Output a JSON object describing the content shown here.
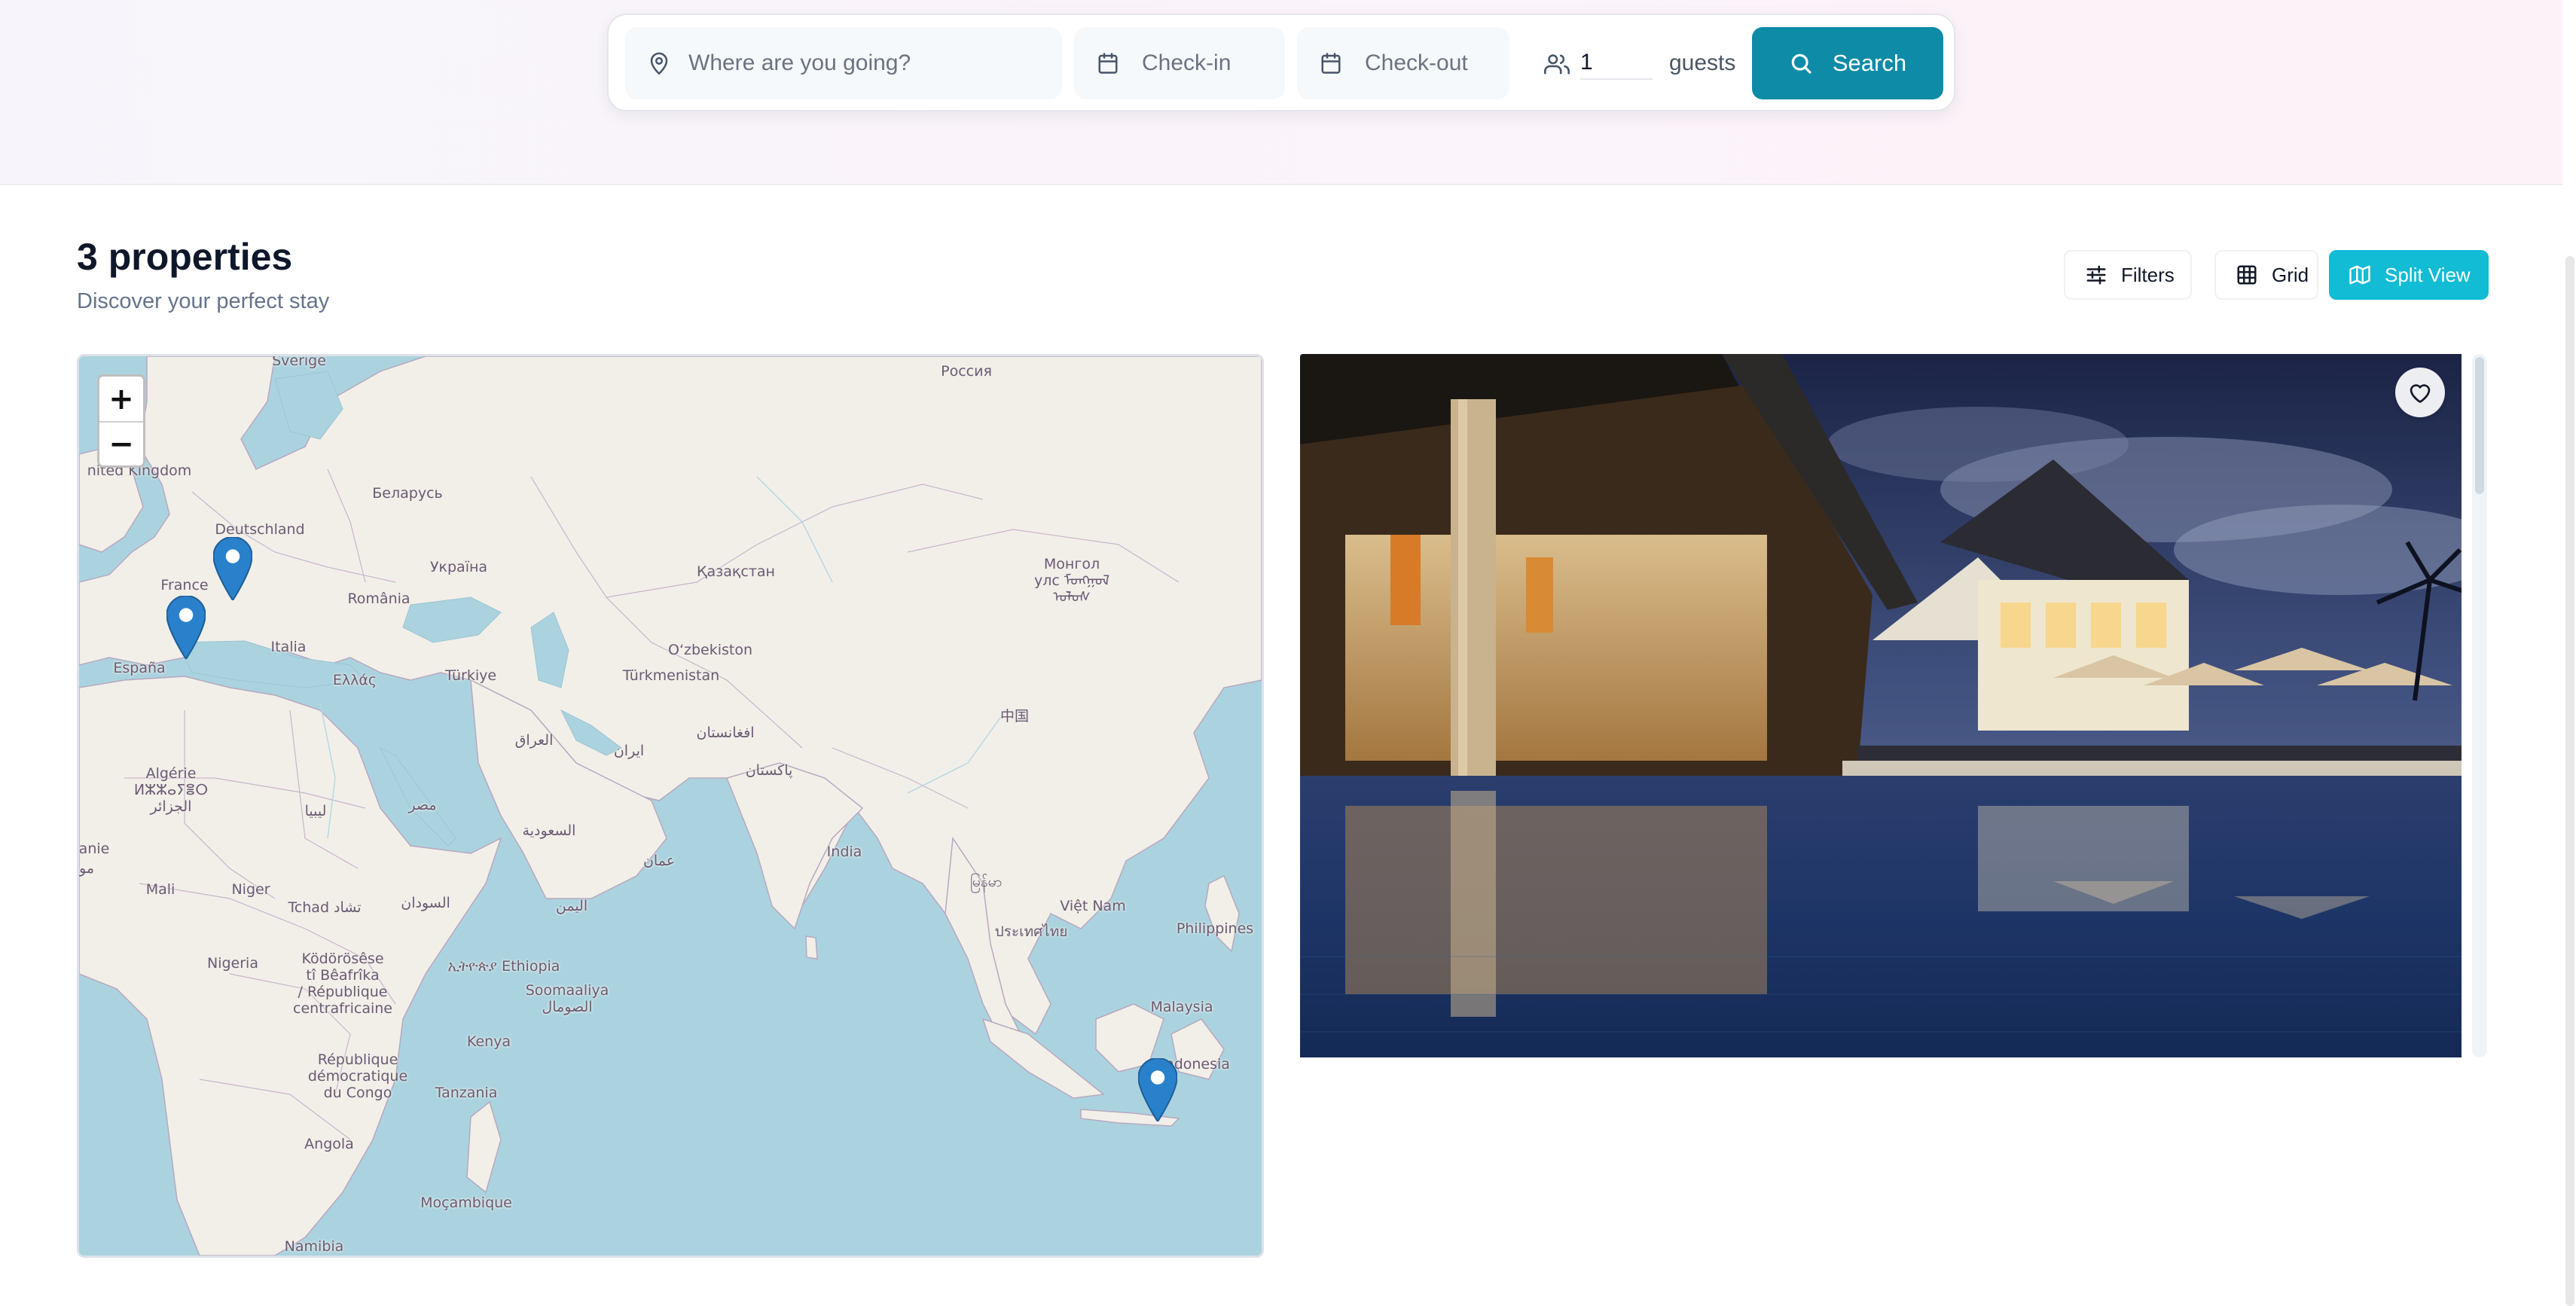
{
  "search": {
    "destination_placeholder": "Where are you going?",
    "checkin_placeholder": "Check-in",
    "checkout_placeholder": "Check-out",
    "guests_value": "1",
    "guests_label": "guests",
    "search_label": "Search"
  },
  "results": {
    "title": "3 properties",
    "subtitle": "Discover your perfect stay"
  },
  "view_controls": {
    "filters_label": "Filters",
    "grid_label": "Grid",
    "split_label": "Split View",
    "active": "Split View"
  },
  "map": {
    "zoom_in": "+",
    "zoom_out": "−",
    "labels": {
      "sverige": "Sverige",
      "rossiya": "Россия",
      "united_kingdom": "nited Kingdom",
      "belarus": "Беларусь",
      "deutschland": "Deutschland",
      "ukraina": "Україна",
      "france": "France",
      "kazakhstan": "Қазақстан",
      "mongolia": "Монгол\nулс ᠮᠣᠩᠭᠣᠯ\nᠤᠯᠤᠰ",
      "romania": "România",
      "uzbekistan": "O‘zbekiston",
      "italia": "Italia",
      "espana": "España",
      "ellas": "Ελλάς",
      "turkiye": "Türkiye",
      "turkmenistan": "Türkmenistan",
      "china": "中国",
      "afghanistan": "افغانستان",
      "iraq": "العراق",
      "iran": "ایران",
      "pakistan": "پاکستان",
      "algerie": "Algérie\nⵍⵣⵣⴰⵢⴻⵔ\nالجزائر",
      "libya": "ليبيا",
      "misr": "مصر",
      "saudi": "السعودية",
      "oman": "عمان",
      "india": "India",
      "myanmar": "မြန်မာ",
      "mauritanie": "anie",
      "mo": "مو",
      "mali": "Mali",
      "niger": "Niger",
      "tchad": "Tchad تشاد",
      "sudan": "السودان",
      "yemen": "اليمن",
      "vietnam": "Việt Nam",
      "thailand": "ประเทศไทย",
      "philippines": "Philippines",
      "nigeria": "Nigeria",
      "car": "Ködörösêse\ntî Bêafrîka\n/ République\ncentrafricaine",
      "ethiopia": "ኢትዮጵያ Ethiopia",
      "somalia": "Soomaaliya\nالصومال",
      "malaysia": "Malaysia",
      "drc": "République\ndémocratique\ndu Congo",
      "kenya": "Kenya",
      "indonesia": "Indonesia",
      "tanzania": "Tanzania",
      "angola": "Angola",
      "mocambique": "Moçambique",
      "namibia": "Namibia"
    },
    "markers": [
      "Property near Nice",
      "Property in Spain",
      "Property in Bali"
    ]
  },
  "property": {
    "image_alt": "Resort with illuminated pool at dusk",
    "favorite": "heart-icon"
  },
  "colors": {
    "brand": "#0e8ba6",
    "split_active": "#11bcd4",
    "marker": "#2a81cb",
    "ocean": "#aad3df",
    "land": "#f2efe9"
  }
}
